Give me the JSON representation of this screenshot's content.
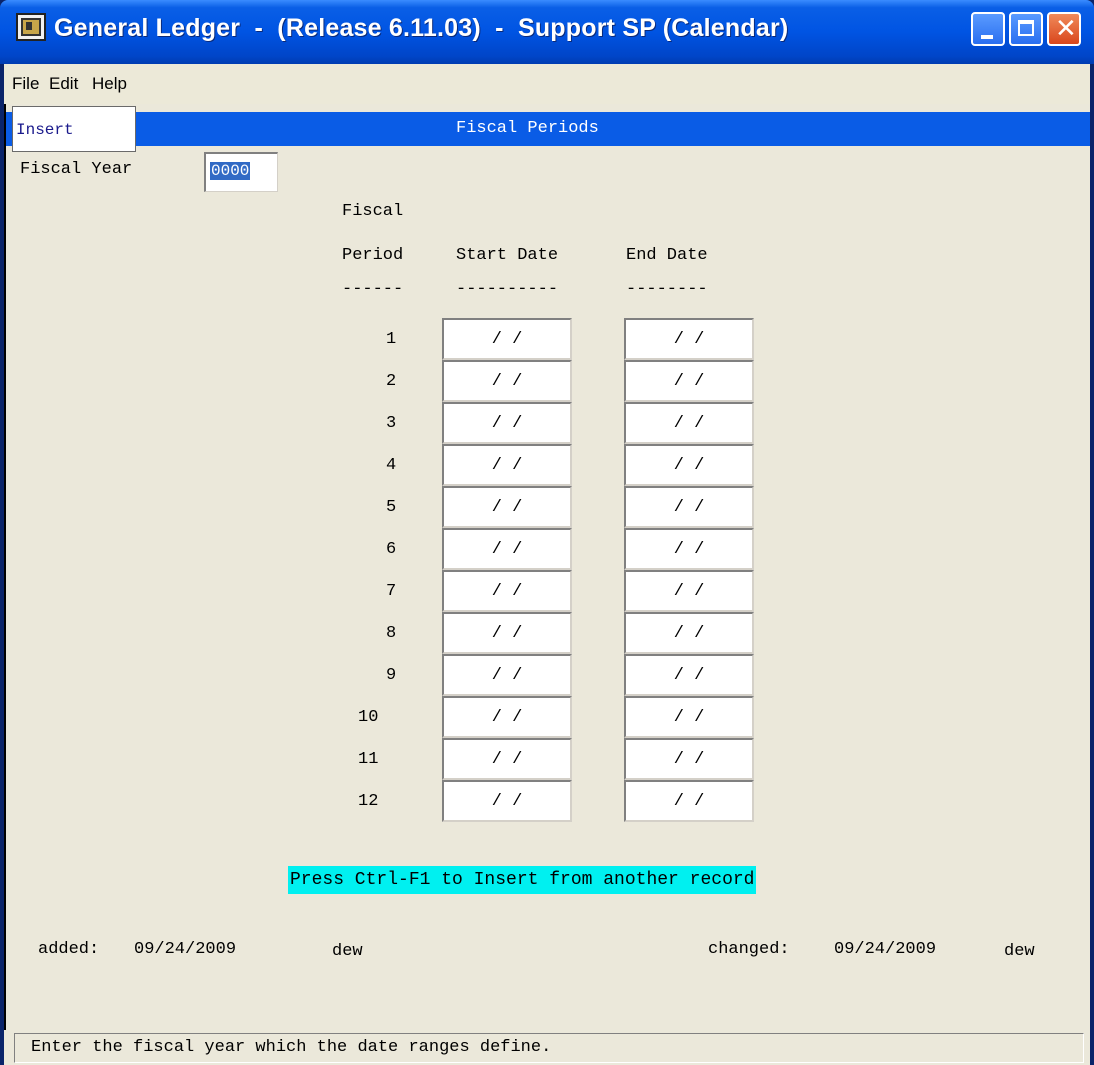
{
  "window": {
    "title": "General Ledger  -  (Release 6.11.03)  -  Support SP (Calendar)",
    "close_glyph": "✕"
  },
  "menu": {
    "items": [
      "File",
      "Edit",
      "Help"
    ]
  },
  "form": {
    "mode": "Insert",
    "heading": "Fiscal Periods",
    "fiscal_year_label": "Fiscal Year",
    "fiscal_year_value": "0000",
    "columns": {
      "period_top": "Fiscal",
      "period": "Period",
      "start": "Start Date",
      "end": "End Date",
      "rule_period": "------",
      "rule_start": "----------",
      "rule_end": "--------"
    },
    "periods": [
      {
        "num": "1",
        "start": "/ /",
        "end": "/ /"
      },
      {
        "num": "2",
        "start": "/ /",
        "end": "/ /"
      },
      {
        "num": "3",
        "start": "/ /",
        "end": "/ /"
      },
      {
        "num": "4",
        "start": "/ /",
        "end": "/ /"
      },
      {
        "num": "5",
        "start": "/ /",
        "end": "/ /"
      },
      {
        "num": "6",
        "start": "/ /",
        "end": "/ /"
      },
      {
        "num": "7",
        "start": "/ /",
        "end": "/ /"
      },
      {
        "num": "8",
        "start": "/ /",
        "end": "/ /"
      },
      {
        "num": "9",
        "start": "/ /",
        "end": "/ /"
      },
      {
        "num": "10",
        "start": "/ /",
        "end": "/ /"
      },
      {
        "num": "11",
        "start": "/ /",
        "end": "/ /"
      },
      {
        "num": "12",
        "start": "/ /",
        "end": "/ /"
      }
    ],
    "hint": "Press Ctrl-F1 to Insert from another record",
    "added_label": "added:",
    "added_date": "09/24/2009",
    "added_user": "dew",
    "changed_label": "changed:",
    "changed_date": "09/24/2009",
    "changed_user": "dew"
  },
  "status": "Enter the fiscal year which the date ranges define.",
  "colors": {
    "title_blue": "#0054e3",
    "header_blue": "#0a5ce6",
    "form_bg": "#ebe8da",
    "hint_bg": "#00f0f0"
  }
}
